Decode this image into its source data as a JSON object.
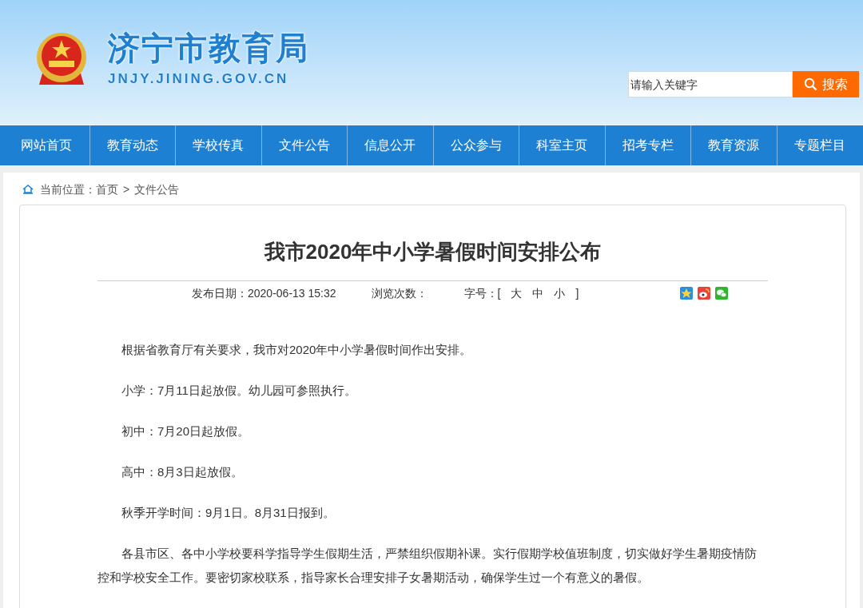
{
  "header": {
    "site_name": "济宁市教育局",
    "site_url": "JNJY.JINING.GOV.CN",
    "search": {
      "placeholder": "请输入关键字",
      "button": "搜索"
    }
  },
  "nav": [
    "网站首页",
    "教育动态",
    "学校传真",
    "文件公告",
    "信息公开",
    "公众参与",
    "科室主页",
    "招考专栏",
    "教育资源",
    "专题栏目"
  ],
  "breadcrumb": {
    "label": "当前位置：",
    "items": [
      "首页",
      "文件公告"
    ],
    "separator": ">"
  },
  "article": {
    "title": "我市2020年中小学暑假时间安排公布",
    "date": "发布日期：2020-06-13 15:32",
    "views": "浏览次数：",
    "font_size": {
      "label": "字号：[",
      "options": [
        "大",
        "中",
        "小"
      ],
      "close": "]"
    },
    "paragraphs": [
      "根据省教育厅有关要求，我市对2020年中小学暑假时间作出安排。",
      "小学：7月11日起放假。幼儿园可参照执行。",
      "初中：7月20日起放假。",
      "高中：8月3日起放假。",
      "秋季开学时间：9月1日。8月31日报到。",
      "各县市区、各中小学校要科学指导学生假期生活，严禁组织假期补课。实行假期学校值班制度，切实做好学生暑期疫情防控和学校安全工作。要密切家校联系，指导家长合理安排子女暑期活动，确保学生过一个有意义的暑假。"
    ]
  }
}
